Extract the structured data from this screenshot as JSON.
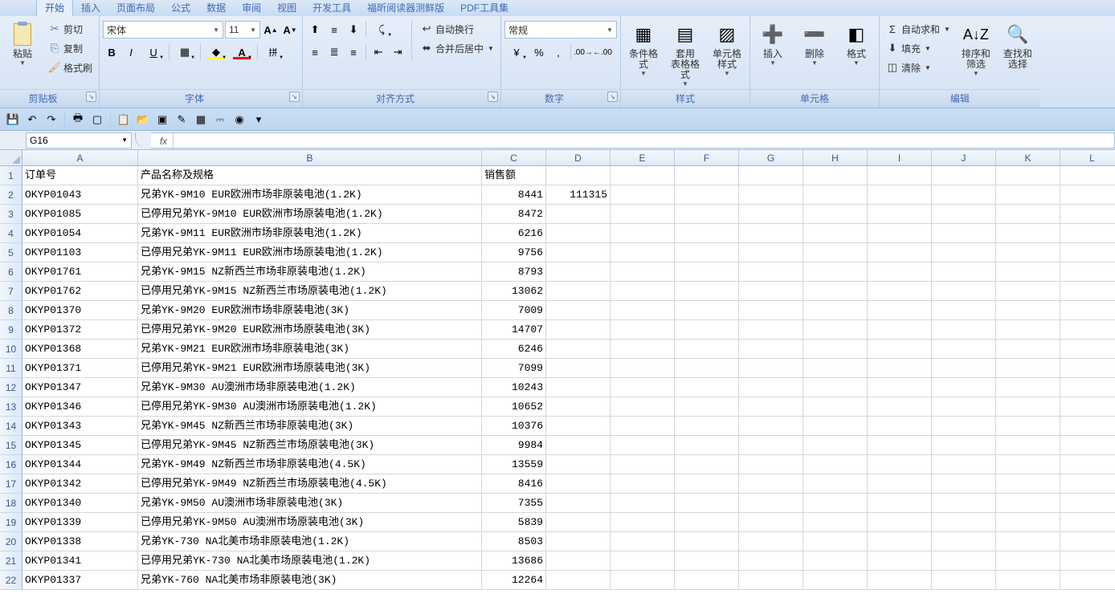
{
  "tabs": [
    "开始",
    "插入",
    "页面布局",
    "公式",
    "数据",
    "审阅",
    "视图",
    "开发工具",
    "福昕阅读器测鲜版",
    "PDF工具集"
  ],
  "activeTab": 0,
  "clipboard": {
    "paste": "粘贴",
    "cut": "剪切",
    "copy": "复制",
    "brush": "格式刷",
    "label": "剪贴板"
  },
  "font": {
    "name": "宋体",
    "size": "11",
    "label": "字体"
  },
  "align": {
    "wrap": "自动换行",
    "merge": "合并后居中",
    "label": "对齐方式"
  },
  "number": {
    "format": "常规",
    "label": "数字"
  },
  "styles": {
    "cond": "条件格式",
    "table": "套用\n表格格式",
    "cell": "单元格\n样式",
    "label": "样式"
  },
  "cells": {
    "insert": "插入",
    "delete": "删除",
    "format": "格式",
    "label": "单元格"
  },
  "edit": {
    "sum": "自动求和",
    "fill": "填充",
    "clear": "清除",
    "sort": "排序和\n筛选",
    "find": "查找和\n选择",
    "label": "编辑"
  },
  "namebox": "G16",
  "columns": [
    "A",
    "B",
    "C",
    "D",
    "E",
    "F",
    "G",
    "H",
    "I",
    "J",
    "K",
    "L"
  ],
  "rows": [
    {
      "n": 1,
      "a": "订单号",
      "b": "产品名称及规格",
      "c": "销售额",
      "d": ""
    },
    {
      "n": 2,
      "a": "OKYP01043",
      "b": "兄弟YK-9M10 EUR欧洲市场非原装电池(1.2K)",
      "c": "8441",
      "d": "111315"
    },
    {
      "n": 3,
      "a": "OKYP01085",
      "b": "已停用兄弟YK-9M10 EUR欧洲市场原装电池(1.2K)",
      "c": "8472",
      "d": ""
    },
    {
      "n": 4,
      "a": "OKYP01054",
      "b": "兄弟YK-9M11 EUR欧洲市场非原装电池(1.2K)",
      "c": "6216",
      "d": ""
    },
    {
      "n": 5,
      "a": "OKYP01103",
      "b": "已停用兄弟YK-9M11 EUR欧洲市场原装电池(1.2K)",
      "c": "9756",
      "d": ""
    },
    {
      "n": 6,
      "a": "OKYP01761",
      "b": "兄弟YK-9M15 NZ新西兰市场非原装电池(1.2K)",
      "c": "8793",
      "d": ""
    },
    {
      "n": 7,
      "a": "OKYP01762",
      "b": "已停用兄弟YK-9M15 NZ新西兰市场原装电池(1.2K)",
      "c": "13062",
      "d": ""
    },
    {
      "n": 8,
      "a": "OKYP01370",
      "b": "兄弟YK-9M20 EUR欧洲市场非原装电池(3K)",
      "c": "7009",
      "d": ""
    },
    {
      "n": 9,
      "a": "OKYP01372",
      "b": "已停用兄弟YK-9M20 EUR欧洲市场原装电池(3K)",
      "c": "14707",
      "d": ""
    },
    {
      "n": 10,
      "a": "OKYP01368",
      "b": "兄弟YK-9M21 EUR欧洲市场非原装电池(3K)",
      "c": "6246",
      "d": ""
    },
    {
      "n": 11,
      "a": "OKYP01371",
      "b": "已停用兄弟YK-9M21 EUR欧洲市场原装电池(3K)",
      "c": "7099",
      "d": ""
    },
    {
      "n": 12,
      "a": "OKYP01347",
      "b": "兄弟YK-9M30 AU澳洲市场非原装电池(1.2K)",
      "c": "10243",
      "d": ""
    },
    {
      "n": 13,
      "a": "OKYP01346",
      "b": "已停用兄弟YK-9M30 AU澳洲市场原装电池(1.2K)",
      "c": "10652",
      "d": ""
    },
    {
      "n": 14,
      "a": "OKYP01343",
      "b": "兄弟YK-9M45 NZ新西兰市场非原装电池(3K)",
      "c": "10376",
      "d": ""
    },
    {
      "n": 15,
      "a": "OKYP01345",
      "b": "已停用兄弟YK-9M45 NZ新西兰市场原装电池(3K)",
      "c": "9984",
      "d": ""
    },
    {
      "n": 16,
      "a": "OKYP01344",
      "b": "兄弟YK-9M49 NZ新西兰市场非原装电池(4.5K)",
      "c": "13559",
      "d": ""
    },
    {
      "n": 17,
      "a": "OKYP01342",
      "b": "已停用兄弟YK-9M49 NZ新西兰市场原装电池(4.5K)",
      "c": "8416",
      "d": ""
    },
    {
      "n": 18,
      "a": "OKYP01340",
      "b": "兄弟YK-9M50 AU澳洲市场非原装电池(3K)",
      "c": "7355",
      "d": ""
    },
    {
      "n": 19,
      "a": "OKYP01339",
      "b": "已停用兄弟YK-9M50 AU澳洲市场原装电池(3K)",
      "c": "5839",
      "d": ""
    },
    {
      "n": 20,
      "a": "OKYP01338",
      "b": "兄弟YK-730 NA北美市场非原装电池(1.2K)",
      "c": "8503",
      "d": ""
    },
    {
      "n": 21,
      "a": "OKYP01341",
      "b": "已停用兄弟YK-730 NA北美市场原装电池(1.2K)",
      "c": "13686",
      "d": ""
    },
    {
      "n": 22,
      "a": "OKYP01337",
      "b": "兄弟YK-760 NA北美市场非原装电池(3K)",
      "c": "12264",
      "d": ""
    }
  ]
}
